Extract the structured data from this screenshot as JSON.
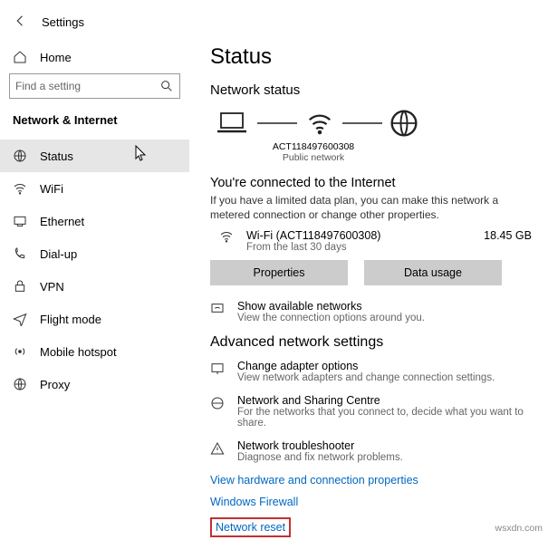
{
  "window": {
    "title": "Settings"
  },
  "sidebar": {
    "home": "Home",
    "search_placeholder": "Find a setting",
    "heading": "Network & Internet",
    "items": [
      {
        "label": "Status",
        "selected": true
      },
      {
        "label": "WiFi"
      },
      {
        "label": "Ethernet"
      },
      {
        "label": "Dial-up"
      },
      {
        "label": "VPN"
      },
      {
        "label": "Flight mode"
      },
      {
        "label": "Mobile hotspot"
      },
      {
        "label": "Proxy"
      }
    ]
  },
  "main": {
    "title": "Status",
    "subtitle": "Network status",
    "diagram": {
      "ssid": "ACT118497600308",
      "net_type": "Public network"
    },
    "connected_heading": "You're connected to the Internet",
    "connected_desc": "If you have a limited data plan, you can make this network a metered connection or change other properties.",
    "conn": {
      "name": "Wi-Fi (ACT118497600308)",
      "sub": "From the last 30 days",
      "usage": "18.45 GB"
    },
    "buttons": {
      "properties": "Properties",
      "data_usage": "Data usage"
    },
    "show_networks": {
      "title": "Show available networks",
      "sub": "View the connection options around you."
    },
    "adv_heading": "Advanced network settings",
    "adapter": {
      "title": "Change adapter options",
      "sub": "View network adapters and change connection settings."
    },
    "sharing": {
      "title": "Network and Sharing Centre",
      "sub": "For the networks that you connect to, decide what you want to share."
    },
    "trouble": {
      "title": "Network troubleshooter",
      "sub": "Diagnose and fix network problems."
    },
    "links": {
      "hw": "View hardware and connection properties",
      "firewall": "Windows Firewall",
      "reset": "Network reset"
    }
  },
  "watermark": "wsxdn.com"
}
